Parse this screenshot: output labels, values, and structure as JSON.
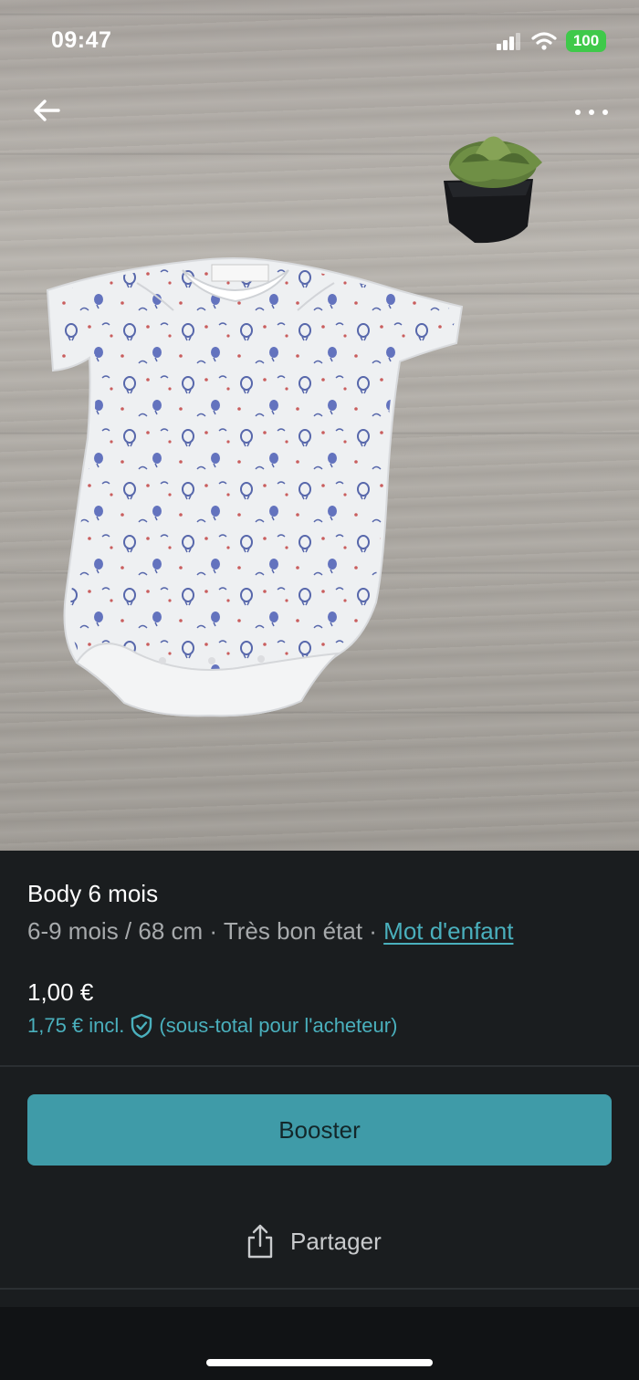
{
  "status_bar": {
    "time": "09:47",
    "battery": "100",
    "icons": [
      "signal-icon",
      "wifi-icon",
      "battery-icon"
    ]
  },
  "nav": {
    "back_icon": "back-arrow-icon",
    "more_icon": "more-dots-icon"
  },
  "item": {
    "title": "Body 6 mois",
    "size": "6-9 mois / 68 cm",
    "separator": " · ",
    "condition": "Très bon état",
    "brand": "Mot d'enfant",
    "price": "1,00 €",
    "buyer_total_prefix": "1,75 € incl.",
    "buyer_total_suffix": "(sous-total pour l'acheteur)"
  },
  "actions": {
    "booster_label": "Booster",
    "share_label": "Partager"
  },
  "colors": {
    "accent": "#3f9ba8",
    "link": "#4ab0bd",
    "background": "#1a1d1f",
    "battery": "#3fc94a"
  }
}
